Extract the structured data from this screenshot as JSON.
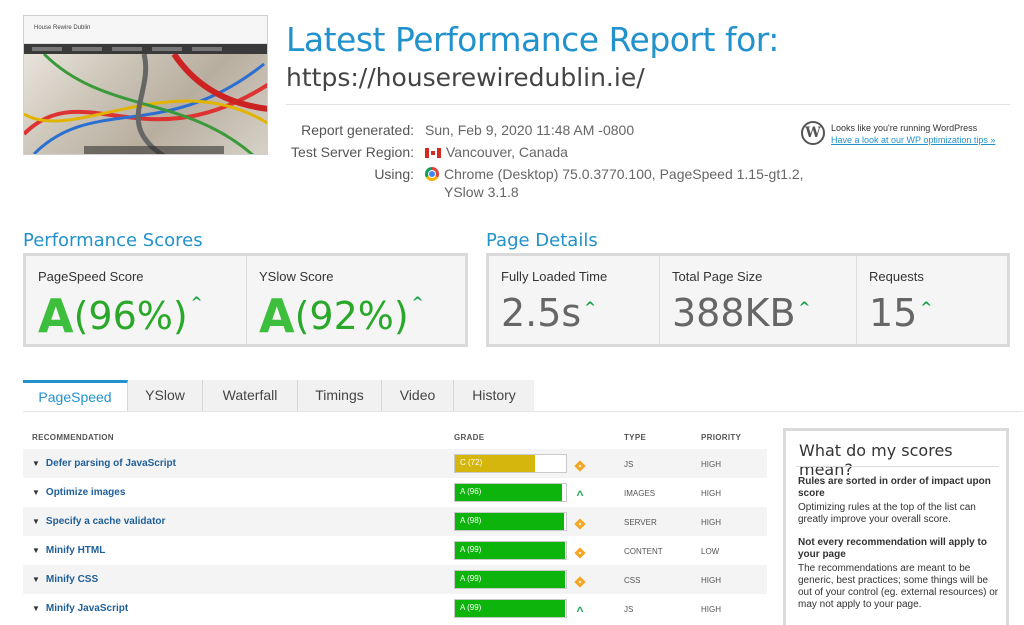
{
  "thumbnail": {
    "site_title": "House Rewire Dublin"
  },
  "header": {
    "title": "Latest Performance Report for:",
    "url": "https://houserewiredublin.ie/"
  },
  "meta": {
    "report_generated_label": "Report generated:",
    "report_generated_value": "Sun, Feb 9, 2020 11:48 AM -0800",
    "region_label": "Test Server Region:",
    "region_value": "Vancouver, Canada",
    "using_label": "Using:",
    "using_value_line1": "Chrome (Desktop) 75.0.3770.100, PageSpeed 1.15-gt1.2,",
    "using_value_line2": "YSlow 3.1.8"
  },
  "wordpress": {
    "text": "Looks like you're running WordPress",
    "link": "Have a look at our WP optimization tips »"
  },
  "performance": {
    "title": "Performance Scores",
    "pagespeed": {
      "label": "PageSpeed Score",
      "grade": "A",
      "pct": "(96%)"
    },
    "yslow": {
      "label": "YSlow Score",
      "grade": "A",
      "pct": "(92%)"
    }
  },
  "details": {
    "title": "Page Details",
    "fully_loaded": {
      "label": "Fully Loaded Time",
      "value": "2.5s"
    },
    "page_size": {
      "label": "Total Page Size",
      "value": "388KB"
    },
    "requests": {
      "label": "Requests",
      "value": "15"
    }
  },
  "tabs": [
    "PageSpeed",
    "YSlow",
    "Waterfall",
    "Timings",
    "Video",
    "History"
  ],
  "table": {
    "headers": {
      "recommendation": "RECOMMENDATION",
      "grade": "GRADE",
      "type": "TYPE",
      "priority": "PRIORITY"
    },
    "rows": [
      {
        "name": "Defer parsing of JavaScript",
        "grade": "C (72)",
        "score": 72,
        "color": "#d4b60c",
        "indicator": "diamond",
        "type": "JS",
        "priority": "HIGH"
      },
      {
        "name": "Optimize images",
        "grade": "A (96)",
        "score": 96,
        "color": "#0cb40c",
        "indicator": "up",
        "type": "IMAGES",
        "priority": "HIGH"
      },
      {
        "name": "Specify a cache validator",
        "grade": "A (98)",
        "score": 98,
        "color": "#0cb40c",
        "indicator": "diamond",
        "type": "SERVER",
        "priority": "HIGH"
      },
      {
        "name": "Minify HTML",
        "grade": "A (99)",
        "score": 99,
        "color": "#0cb40c",
        "indicator": "diamond",
        "type": "CONTENT",
        "priority": "LOW"
      },
      {
        "name": "Minify CSS",
        "grade": "A (99)",
        "score": 99,
        "color": "#0cb40c",
        "indicator": "diamond",
        "type": "CSS",
        "priority": "HIGH"
      },
      {
        "name": "Minify JavaScript",
        "grade": "A (99)",
        "score": 99,
        "color": "#0cb40c",
        "indicator": "up",
        "type": "JS",
        "priority": "HIGH"
      }
    ]
  },
  "side": {
    "title": "What do my scores mean?",
    "b1": "Rules are sorted in order of impact upon score",
    "p1": "Optimizing rules at the top of the list can greatly improve your overall score.",
    "b2": "Not every recommendation will apply to your page",
    "p2": "The recommendations are meant to be generic, best practices; some things will be out of your control (eg. external resources) or may not apply to your page."
  }
}
